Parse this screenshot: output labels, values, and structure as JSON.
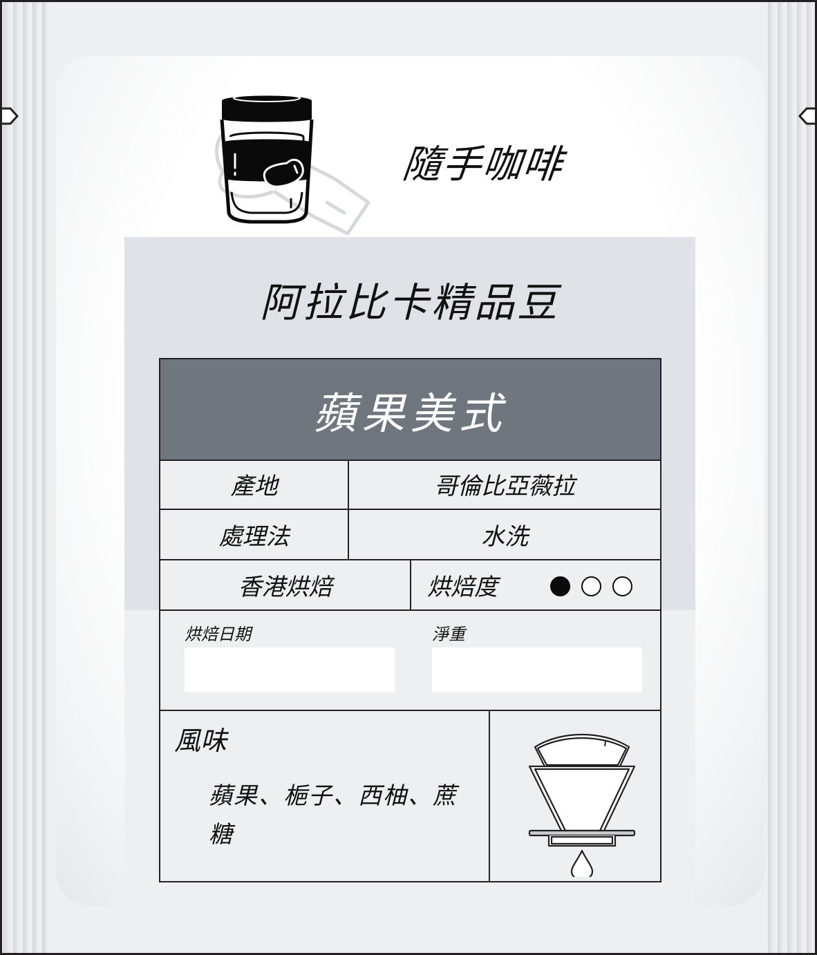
{
  "brand": {
    "name": "隨手咖啡",
    "logo_icon": "coffee-cup-in-hand-icon"
  },
  "product": {
    "line": "阿拉比卡精品豆",
    "name": "蘋果美式"
  },
  "specs": {
    "origin_label": "產地",
    "origin_value": "哥倫比亞薇拉",
    "process_label": "處理法",
    "process_value": "水洗",
    "roaster": "香港烘焙",
    "roast_label": "烘焙度",
    "roast_level": 1,
    "roast_level_max": 3
  },
  "meta": {
    "roast_date_label": "烘焙日期",
    "roast_date_value": "",
    "net_weight_label": "淨重",
    "net_weight_value": ""
  },
  "flavor": {
    "title": "風味",
    "notes": "蘋果、梔子、西柚、蔗糖",
    "icon": "pour-over-dripper-icon"
  },
  "colors": {
    "header_bg": "#6f767e",
    "band_bg": "#dfe3e7",
    "card_bg": "#eeeff1",
    "ink": "#231f20"
  }
}
